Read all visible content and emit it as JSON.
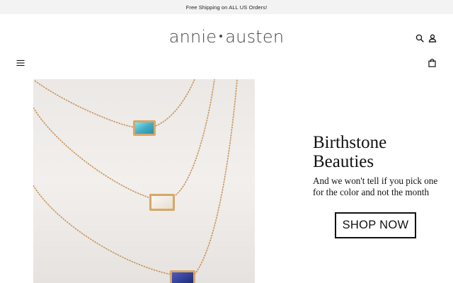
{
  "announcement": {
    "text": "Free Shipping on ALL US Orders!"
  },
  "header": {
    "logo_left": "annie",
    "logo_right": "austen",
    "icons": [
      "search-icon",
      "account-icon",
      "menu-icon",
      "shopping-bag-icon"
    ]
  },
  "hero": {
    "title": "Birthstone Beauties",
    "subtitle": "And we won't tell if you pick one for the color and not the month",
    "cta_label": "SHOP NOW"
  },
  "colors": {
    "announcement_bg": "#f4f3f3",
    "logo": "#4a4447",
    "text": "#111111",
    "gold_chain": "#c8965a",
    "aquamarine": "#4fb3c9",
    "sapphire": "#2b3a8f"
  }
}
